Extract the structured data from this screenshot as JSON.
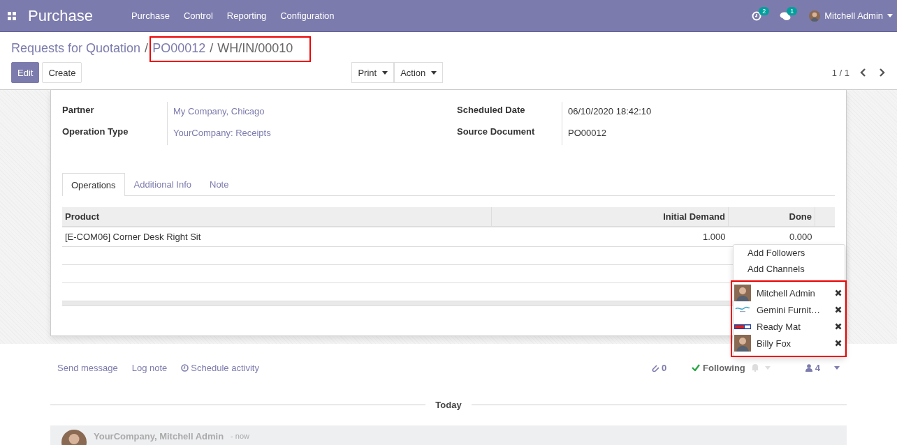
{
  "navbar": {
    "app": "Purchase",
    "menu": [
      "Purchase",
      "Control",
      "Reporting",
      "Configuration"
    ],
    "activity_count": "2",
    "message_count": "1",
    "user": "Mitchell Admin"
  },
  "breadcrumbs": {
    "items": [
      "Requests for Quotation",
      "PO00012",
      "WH/IN/00010"
    ],
    "separator": "/"
  },
  "buttons": {
    "edit": "Edit",
    "create": "Create",
    "print": "Print",
    "action": "Action"
  },
  "pager": "1 / 1",
  "form": {
    "left": [
      {
        "label": "Partner",
        "value": "My Company, Chicago",
        "link": true
      },
      {
        "label": "Operation Type",
        "value": "YourCompany: Receipts",
        "link": true
      }
    ],
    "right": [
      {
        "label": "Scheduled Date",
        "value": "06/10/2020 18:42:10",
        "link": false
      },
      {
        "label": "Source Document",
        "value": "PO00012",
        "link": false
      }
    ]
  },
  "tabs": [
    {
      "label": "Operations",
      "selected": true
    },
    {
      "label": "Additional Info",
      "selected": false
    },
    {
      "label": "Note",
      "selected": false
    }
  ],
  "table": {
    "columns": [
      "Product",
      "Initial Demand",
      "Done"
    ],
    "rows": [
      [
        "[E-COM06] Corner Desk Right Sit",
        "1.000",
        "0.000"
      ]
    ]
  },
  "chatter": {
    "send": "Send message",
    "log": "Log note",
    "schedule": "Schedule activity",
    "attachments": "0",
    "following": "Following",
    "followers_count": "4",
    "divider": "Today",
    "message": {
      "author": "YourCompany, Mitchell Admin",
      "separator": "-",
      "time": "now"
    }
  },
  "followers_menu": {
    "actions": [
      "Add Followers",
      "Add Channels"
    ],
    "followers": [
      {
        "name": "Mitchell Admin",
        "kind": "person"
      },
      {
        "name": "Gemini Furnit…",
        "kind": "logo"
      },
      {
        "name": "Ready Mat",
        "kind": "banner"
      },
      {
        "name": "Billy Fox",
        "kind": "person"
      }
    ]
  }
}
